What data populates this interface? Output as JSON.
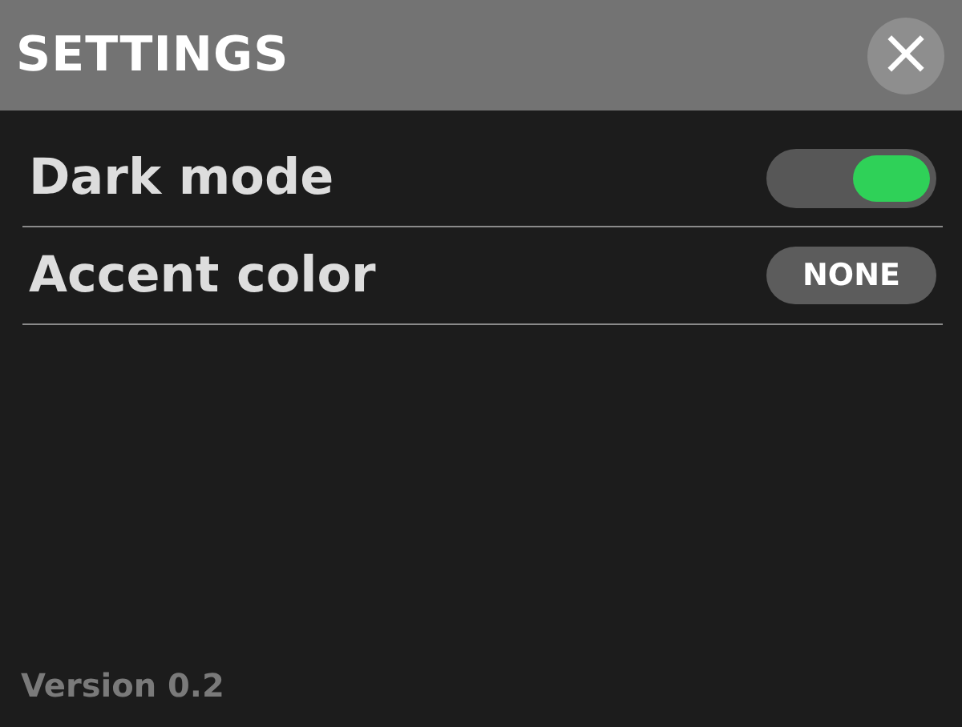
{
  "header": {
    "title": "SETTINGS",
    "close_icon": "×"
  },
  "settings": [
    {
      "kind": "toggle",
      "label": "Dark mode",
      "on": true
    },
    {
      "kind": "button",
      "label": "Accent color",
      "value": "NONE"
    }
  ],
  "footer": {
    "version": "Version 0.2"
  }
}
